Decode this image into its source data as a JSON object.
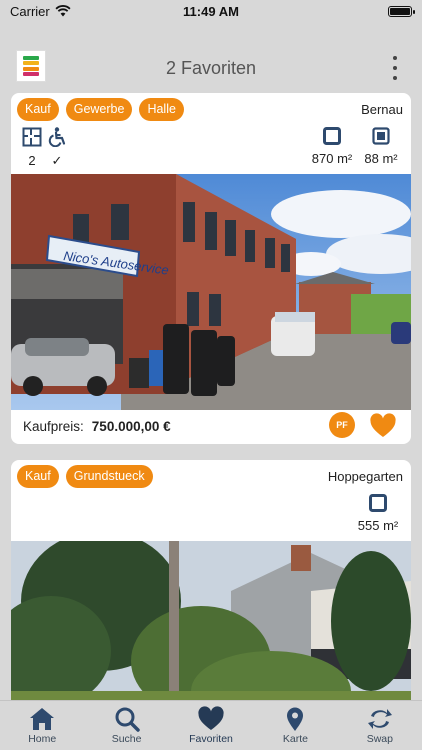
{
  "status_bar": {
    "carrier": "Carrier",
    "time": "11:49 AM"
  },
  "header": {
    "title": "2 Favoriten"
  },
  "colors": {
    "accent": "#f08a12",
    "navy": "#2e4a6e"
  },
  "listings": [
    {
      "tags": [
        "Kauf",
        "Gewerbe",
        "Halle"
      ],
      "location": "Bernau",
      "features": [
        {
          "icon": "floorplan-icon",
          "value": "2"
        },
        {
          "icon": "wheelchair-icon",
          "value": "✓"
        },
        {
          "icon": "plot-area-icon",
          "value": "870 m²"
        },
        {
          "icon": "living-area-icon",
          "value": "88 m²"
        }
      ],
      "photo_sign": "Nico's Autoservice",
      "price_label": "Kaufpreis:",
      "price_value": "750.000,00 €",
      "pf_label": "PF"
    },
    {
      "tags": [
        "Kauf",
        "Grundstueck"
      ],
      "location": "Hoppegarten",
      "features": [
        {
          "icon": "plot-area-icon",
          "value": "555 m²"
        }
      ]
    }
  ],
  "tabs": [
    {
      "label": "Home",
      "icon": "home-icon"
    },
    {
      "label": "Suche",
      "icon": "search-icon"
    },
    {
      "label": "Favoriten",
      "icon": "heart-icon",
      "active": true
    },
    {
      "label": "Karte",
      "icon": "map-pin-icon"
    },
    {
      "label": "Swap",
      "icon": "swap-icon"
    }
  ]
}
